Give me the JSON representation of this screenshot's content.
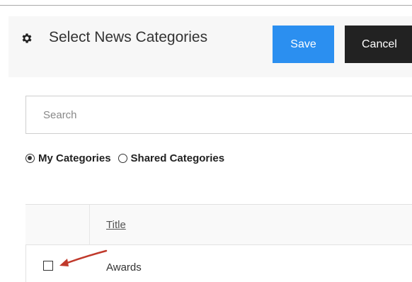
{
  "header": {
    "title": "Select News Categories",
    "save_label": "Save",
    "cancel_label": "Cancel"
  },
  "search": {
    "placeholder": "Search",
    "value": ""
  },
  "filter": {
    "options": [
      {
        "label": "My Categories",
        "selected": true
      },
      {
        "label": "Shared Categories",
        "selected": false
      }
    ]
  },
  "table": {
    "columns": [
      "",
      "Title"
    ],
    "rows": [
      {
        "checked": false,
        "title": "Awards"
      }
    ]
  },
  "icons": {
    "header_icon": "gear-icon",
    "annotation": "red-arrow-icon"
  },
  "colors": {
    "save_button": "#2b8ff0",
    "cancel_button": "#222222",
    "arrow": "#c0392b"
  }
}
